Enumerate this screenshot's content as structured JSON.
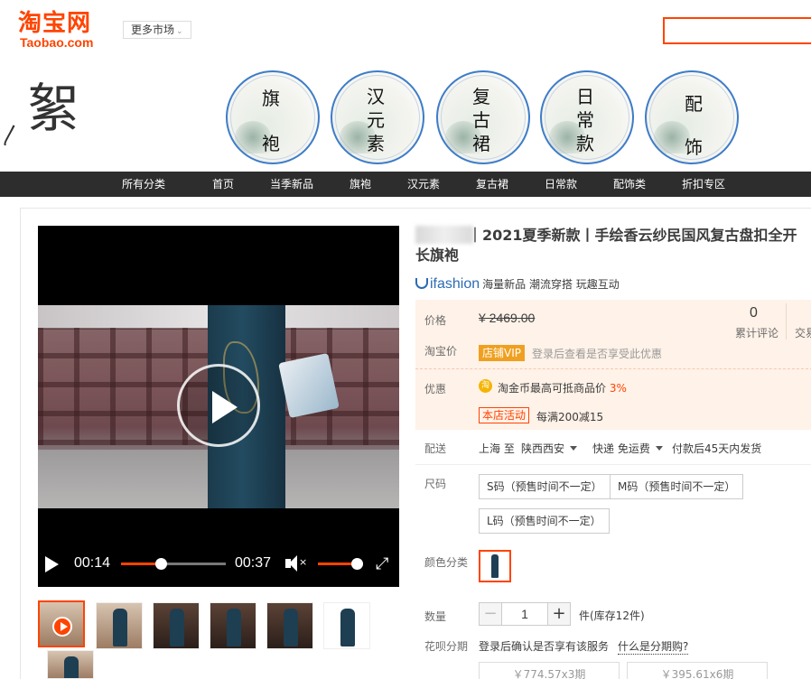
{
  "header": {
    "logo_cn": "淘宝网",
    "logo_en": "Taobao.com",
    "more_market": "更多市场",
    "search_placeholder": ""
  },
  "banner": {
    "brush_char": "絮",
    "circles": [
      {
        "name": "qipao",
        "lines": [
          "旗",
          "袍"
        ]
      },
      {
        "name": "hanyuansu",
        "lines": [
          "汉",
          "元",
          "素"
        ]
      },
      {
        "name": "fuguqun",
        "lines": [
          "复",
          "古",
          "裙"
        ]
      },
      {
        "name": "richangkuan",
        "lines": [
          "日",
          "常",
          "款"
        ]
      },
      {
        "name": "peishi",
        "lines": [
          "配",
          "饰"
        ]
      }
    ]
  },
  "nav": [
    "所有分类",
    "首页",
    "当季新品",
    "旗袍",
    "汉元素",
    "复古裙",
    "日常款",
    "配饰类",
    "折扣专区"
  ],
  "video": {
    "current_time": "00:14",
    "total_time": "00:37",
    "progress": 0.38,
    "volume": 0.85
  },
  "product": {
    "title_line1": "｜2021夏季新款丨手绘香云纱民国风复古盘扣全开",
    "title_line2": "长旗袍",
    "ifashion_logo": "ifashion",
    "ifashion_slogan": "海量新品 潮流穿搭 玩趣互动"
  },
  "price": {
    "label": "价格",
    "old_price": "¥ 2469.00",
    "reviews_count": "0",
    "reviews_label": "累计评论",
    "trade_label": "交易",
    "taobao_price_label": "淘宝价",
    "vip_badge": "店铺VIP",
    "vip_note": "登录后查看是否享受此优惠",
    "promo_label": "优惠",
    "coin_icon": "淘",
    "coin_text": "淘金币最高可抵商品价",
    "coin_pct": "3%",
    "activity_badge": "本店活动",
    "activity_text": "每满200减15"
  },
  "shipping": {
    "label": "配送",
    "from": "上海 至",
    "to": "陕西西安",
    "method": "快递 免运费",
    "eta": "付款后45天内发货"
  },
  "size": {
    "label": "尺码",
    "options": [
      "S码（预售时间不一定）",
      "M码（预售时间不一定）",
      "L码（预售时间不一定）"
    ]
  },
  "color": {
    "label": "颜色分类"
  },
  "quantity": {
    "label": "数量",
    "minus": "−",
    "value": "1",
    "plus": "+",
    "stock": "件(库存12件)"
  },
  "installment": {
    "label": "花呗分期",
    "note": "登录后确认是否享有该服务",
    "link": "什么是分期购?",
    "options": [
      "￥774.57x3期",
      "￥395.61x6期"
    ]
  },
  "colors": {
    "accent": "#ff4400",
    "nav_bg": "#2d2d2d",
    "price_panel_bg": "#fff2e8",
    "circle_border": "#3d7cc9"
  }
}
